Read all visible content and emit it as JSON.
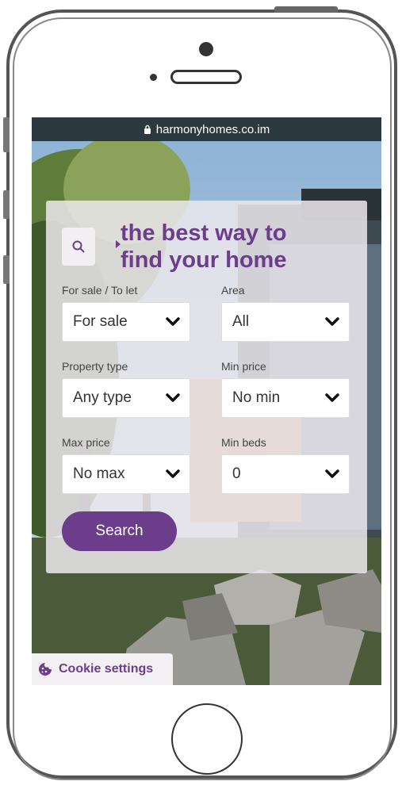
{
  "browser": {
    "url": "harmonyhomes.co.im"
  },
  "hero": {
    "heading_line1": "the best way to",
    "heading_line2": "find your home"
  },
  "form": {
    "sale_type": {
      "label": "For sale / To let",
      "value": "For sale"
    },
    "area": {
      "label": "Area",
      "value": "All"
    },
    "property_type": {
      "label": "Property type",
      "value": "Any type"
    },
    "min_price": {
      "label": "Min price",
      "value": "No min"
    },
    "max_price": {
      "label": "Max price",
      "value": "No max"
    },
    "min_beds": {
      "label": "Min beds",
      "value": "0"
    },
    "search_label": "Search"
  },
  "cookie": {
    "label": "Cookie settings"
  },
  "colors": {
    "brand": "#6b3d8a",
    "url_bar": "#2c3a3f"
  }
}
